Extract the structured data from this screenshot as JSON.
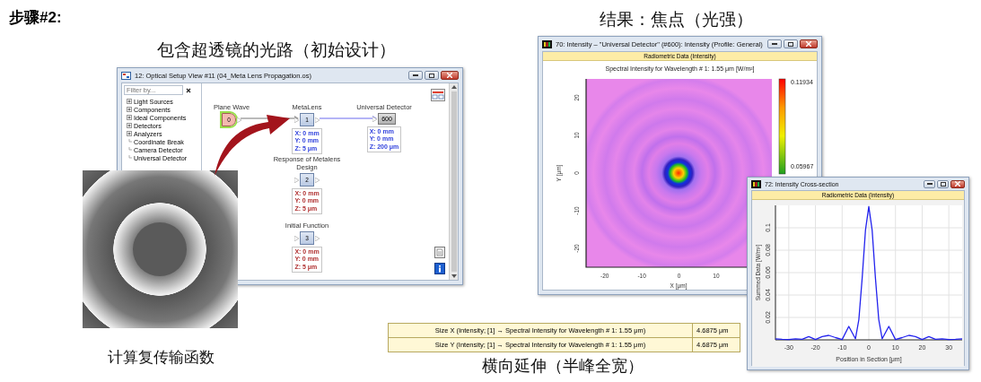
{
  "heading": "步骤#2:",
  "setup_caption": "包含超透镜的光路（初始设计）",
  "result_caption": "结果：焦点（光强）",
  "setup_window": {
    "title": "12: Optical Setup View #11 (04_Meta Lens Propagation.os)",
    "filter": {
      "placeholder": "Filter by..."
    },
    "tree": [
      {
        "label": "Light Sources",
        "kind": "folder"
      },
      {
        "label": "Components",
        "kind": "folder"
      },
      {
        "label": "Ideal Components",
        "kind": "folder"
      },
      {
        "label": "Detectors",
        "kind": "folder"
      },
      {
        "label": "Analyzers",
        "kind": "folder"
      },
      {
        "label": "Coordinate Break",
        "kind": "leaf"
      },
      {
        "label": "Camera Detector",
        "kind": "leaf"
      },
      {
        "label": "Universal Detector",
        "kind": "leaf"
      }
    ],
    "nodes": [
      {
        "label": "Plane Wave",
        "number": "0",
        "kind": "source",
        "selected": true
      },
      {
        "label": "MetaLens",
        "number": "1",
        "kind": "component",
        "selected": false,
        "color": "#3344dd",
        "coords": [
          "X: 0 mm",
          "Y: 0 mm",
          "Z: 5 μm"
        ]
      },
      {
        "label": "Universal Detector",
        "number": "600",
        "kind": "detector",
        "selected": false,
        "color": "#3344dd",
        "coords": [
          "X: 0 mm",
          "Y: 0 mm",
          "Z: 200 μm"
        ]
      },
      {
        "label": "Response of Metalens Design",
        "number": "2",
        "kind": "component",
        "selected": false,
        "color": "#b03030",
        "coords": [
          "X: 0 mm",
          "Y: 0 mm",
          "Z: 5 μm"
        ]
      },
      {
        "label": "Initial Function",
        "number": "3",
        "kind": "component",
        "selected": false,
        "color": "#b03030",
        "coords": [
          "X: 0 mm",
          "Y: 0 mm",
          "Z: 5 μm"
        ]
      }
    ]
  },
  "transfer_caption": "计算复传输函数",
  "intensity_window": {
    "title": "70: Intensity – \"Universal Detector\" (#600): Intensity (Profile: General)",
    "banner": "Radiometric Data (Intensity)",
    "plot_title": "Spectral Intensity for Wavelength # 1: 1.55 μm  [W/m²]",
    "colorbar_labels": [
      "0.11934",
      "0.05967"
    ],
    "x_ticks": [
      "-20",
      "-10",
      "0",
      "10"
    ],
    "y_ticks": [
      "20",
      "10",
      "0",
      "-10",
      "-20"
    ],
    "xlabel": "X [μm]",
    "ylabel": "Y [μm]"
  },
  "cross_section_window": {
    "title": "72: Intensity Cross-section",
    "banner": "Radiometric Data (Intensity)",
    "chart_data": {
      "type": "line",
      "xlabel": "Position in Section [μm]",
      "ylabel": "Summed Data [W/m²]",
      "x": [
        -35,
        -32.5,
        -30,
        -27.5,
        -25,
        -22.5,
        -20,
        -17.5,
        -15,
        -12.5,
        -10,
        -7.5,
        -5,
        -3.75,
        -2.5,
        -1.25,
        0,
        1.25,
        2.5,
        3.75,
        5,
        7.5,
        10,
        12.5,
        15,
        17.5,
        20,
        22.5,
        25,
        27.5,
        30,
        32.5,
        35
      ],
      "grid": true,
      "series": [
        {
          "color": "#2222ee",
          "values": [
            0.001,
            0.0005,
            0.0003,
            0.001,
            0.0005,
            0.003,
            0.0003,
            0.003,
            0.004,
            0.002,
            0.0003,
            0.012,
            0.001,
            0.018,
            0.055,
            0.098,
            0.119,
            0.098,
            0.055,
            0.018,
            0.001,
            0.012,
            0.0003,
            0.002,
            0.004,
            0.003,
            0.0003,
            0.003,
            0.0005,
            0.001,
            0.0003,
            0.0005,
            0.001
          ]
        }
      ],
      "xlim": [
        -35,
        35
      ],
      "ylim": [
        0,
        0.12
      ],
      "xticks": [
        -30,
        -20,
        -10,
        0,
        10,
        20,
        30
      ],
      "yticks": [
        0.02,
        0.04,
        0.06,
        0.08,
        0.1
      ]
    }
  },
  "results_table": {
    "rows": [
      {
        "label": "Size X (Intensity; [1] → Spectral Intensity for Wavelength # 1: 1.55 μm)",
        "value": "4.6875 μm"
      },
      {
        "label": "Size Y (Intensity; [1] → Spectral Intensity for Wavelength # 1: 1.55 μm)",
        "value": "4.6875 μm"
      }
    ]
  },
  "fwhm_caption": "横向延伸（半峰全宽）"
}
